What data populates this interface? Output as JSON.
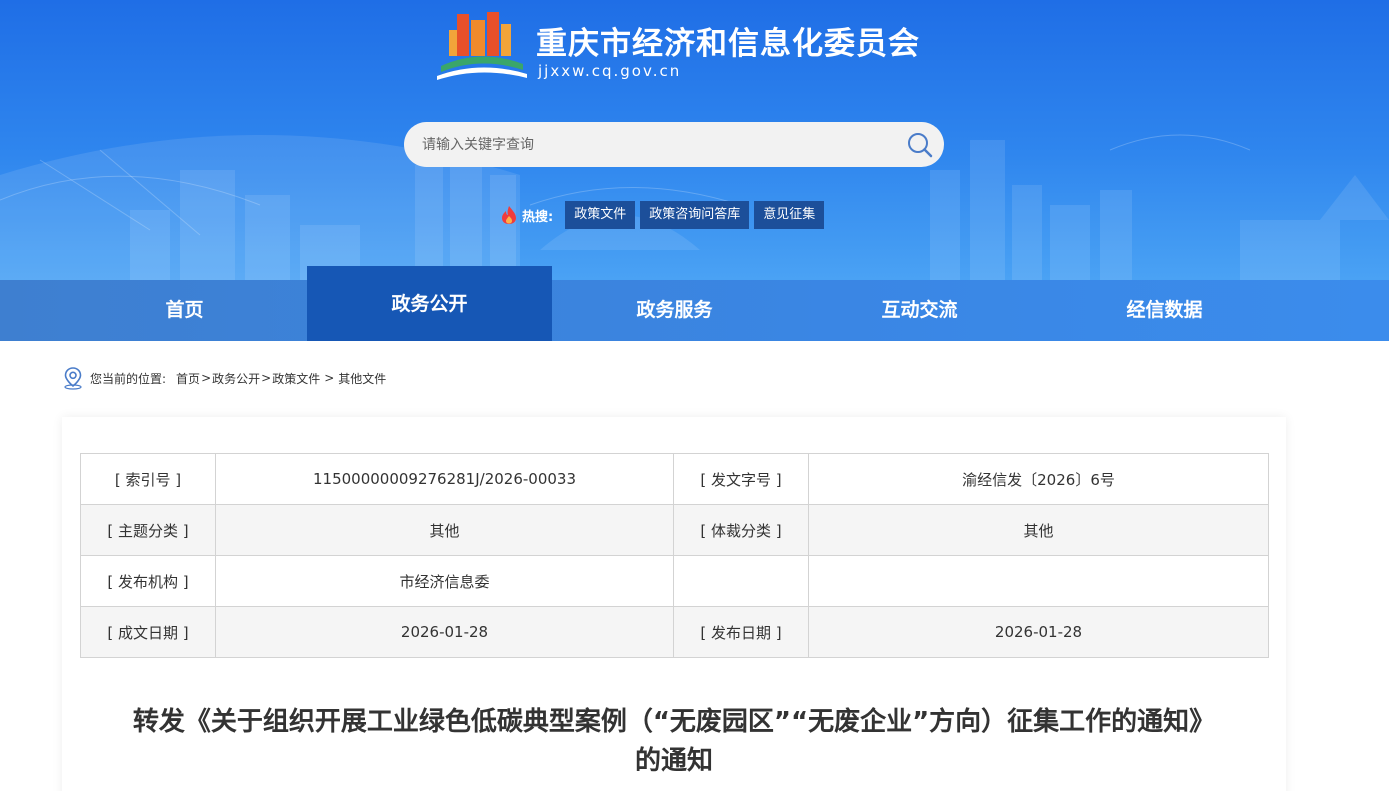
{
  "header": {
    "site_title": "重庆市经济和信息化委员会",
    "site_domain": "jjxxw.cq.gov.cn",
    "search_placeholder": "请输入关键字查询",
    "hot_label": "热搜:",
    "hot_tags": [
      "政策文件",
      "政策咨询问答库",
      "意见征集"
    ]
  },
  "nav": {
    "items": [
      "首页",
      "政务公开",
      "政务服务",
      "互动交流",
      "经信数据"
    ],
    "active": "政务公开"
  },
  "breadcrumb": {
    "label": "您当前的位置:",
    "items": [
      "首页",
      "政务公开",
      "政策文件",
      "其他文件"
    ]
  },
  "meta": {
    "index_no_label": "[ 索引号 ]",
    "index_no": "11500000009276281J/2026-00033",
    "doc_no_label": "[ 发文字号 ]",
    "doc_no": "渝经信发〔2026〕6号",
    "subject_label": "[ 主题分类 ]",
    "subject": "其他",
    "genre_label": "[ 体裁分类 ]",
    "genre": "其他",
    "issuer_label": "[ 发布机构 ]",
    "issuer": "市经济信息委",
    "created_label": "[ 成文日期 ]",
    "created": "2026-01-28",
    "published_label": "[ 发布日期 ]",
    "published": "2026-01-28"
  },
  "article": {
    "title_line1": "转发《关于组织开展工业绿色低碳典型案例（“无废园区”“无废企业”方向）征集工作的通知》",
    "title_line2": "的通知"
  },
  "colors": {
    "banner_top": "#1f6ee6",
    "nav_bg": "#3a86e4",
    "nav_active": "#1657b5",
    "hot_tag_bg": "#1c4f9a"
  }
}
